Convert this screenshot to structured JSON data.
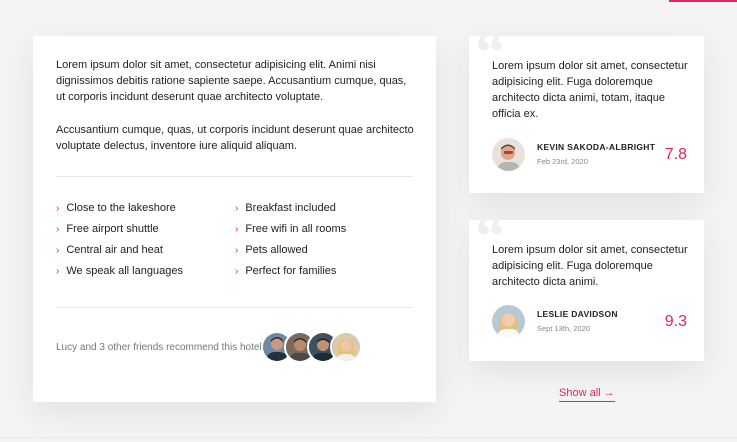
{
  "description": {
    "paragraph_1": "Lorem ipsum dolor sit amet, consectetur adipisicing elit. Animi nisi dignissimos debitis ratione sapiente saepe. Accusantium cumque, quas, ut corporis incidunt deserunt quae architecto voluptate.",
    "paragraph_2": "Accusantium cumque, quas, ut corporis incidunt deserunt quae architecto voluptate delectus, inventore iure aliquid aliquam."
  },
  "amenities": {
    "left": [
      "Close to the lakeshore",
      "Free airport shuttle",
      "Central air and heat",
      "We speak all languages"
    ],
    "right": [
      "Breakfast included",
      "Free wifi in all rooms",
      "Pets allowed",
      "Perfect for families"
    ],
    "bullet_icon": "chevron-right-icon"
  },
  "friends": {
    "text": "Lucy and 3 other friends recommend this hotel."
  },
  "reviews": [
    {
      "text": "Lorem ipsum dolor sit amet, consectetur adipisicing elit. Fuga doloremque architecto dicta animi, totam, itaque officia ex.",
      "name": "KEVIN SAKODA-ALBRIGHT",
      "date": "Feb 23rd, 2020",
      "score": "7.8"
    },
    {
      "text": "Lorem ipsum dolor sit amet, consectetur adipisicing elit. Fuga doloremque architecto dicta animi.",
      "name": "LESLIE DAVIDSON",
      "date": "Sept 13th, 2020",
      "score": "9.3"
    }
  ],
  "show_all": "Show all →",
  "colors": {
    "accent": "#e0245e",
    "background": "#f4f4f4",
    "card": "#ffffff"
  }
}
